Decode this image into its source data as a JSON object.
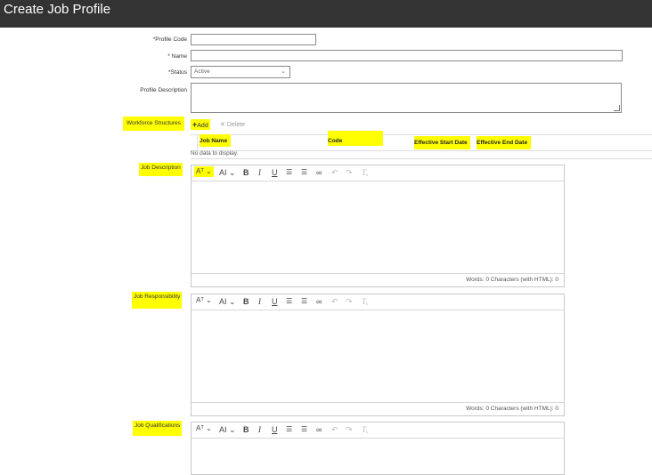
{
  "title": "Create Job Profile",
  "fields": {
    "profile_code_label": "*Profile Code",
    "name_label": "* Name",
    "status_label": "*Status",
    "status_value": "Active",
    "profile_description_label": "Profile Description"
  },
  "workforce": {
    "label": "Workforce Structures",
    "add_label": "Add",
    "delete_label": "Delete",
    "columns": [
      "Job Name",
      "Code",
      "Effective Start Date",
      "Effective End Date"
    ],
    "empty_text": "No data to display."
  },
  "editors": [
    {
      "label": "Job Description",
      "counts": "Words: 0  Characters (with HTML): 0"
    },
    {
      "label": "Job Responsibility",
      "counts": "Words: 0  Characters (with HTML): 0"
    },
    {
      "label": "Job Qualifications",
      "counts": ""
    }
  ],
  "toolbar": {
    "font_size_glyph": "Aᵀ",
    "font_glyph": "AI",
    "bold": "B",
    "italic": "I",
    "underline": "U",
    "ordered_list": "☰",
    "unordered_list": "☰",
    "link": "∞",
    "undo": "↶",
    "redo": "↷",
    "clear_format": "Tₓ"
  },
  "icons": {
    "add_icon": "plus-icon",
    "delete_icon": "x-icon",
    "status_dropdown": "chevron-down-icon"
  },
  "colors": {
    "titlebar": "#333333",
    "highlight": "#ffff00"
  }
}
